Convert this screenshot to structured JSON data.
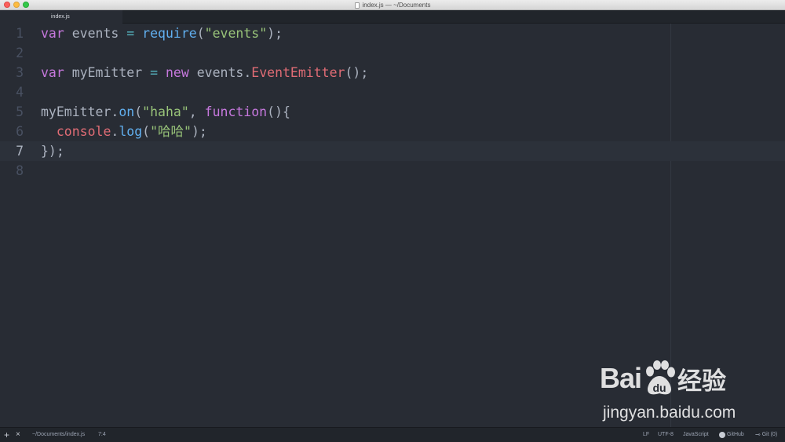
{
  "window": {
    "title": "index.js — ~/Documents"
  },
  "tabs": [
    {
      "label": "index.js"
    }
  ],
  "editor": {
    "cursor_line": 7,
    "lines": [
      {
        "number": "1",
        "tokens": [
          {
            "t": "var",
            "c": "kw"
          },
          {
            "t": " events ",
            "c": "pl"
          },
          {
            "t": "=",
            "c": "op"
          },
          {
            "t": " ",
            "c": "pl"
          },
          {
            "t": "require",
            "c": "fn"
          },
          {
            "t": "(",
            "c": "pl"
          },
          {
            "t": "\"events\"",
            "c": "str"
          },
          {
            "t": ");",
            "c": "pl"
          }
        ]
      },
      {
        "number": "2",
        "tokens": []
      },
      {
        "number": "3",
        "tokens": [
          {
            "t": "var",
            "c": "kw"
          },
          {
            "t": " myEmitter ",
            "c": "pl"
          },
          {
            "t": "=",
            "c": "op"
          },
          {
            "t": " ",
            "c": "pl"
          },
          {
            "t": "new",
            "c": "kw"
          },
          {
            "t": " events.",
            "c": "pl"
          },
          {
            "t": "EventEmitter",
            "c": "cls"
          },
          {
            "t": "();",
            "c": "pl"
          }
        ]
      },
      {
        "number": "4",
        "tokens": []
      },
      {
        "number": "5",
        "tokens": [
          {
            "t": "myEmitter.",
            "c": "pl"
          },
          {
            "t": "on",
            "c": "fn"
          },
          {
            "t": "(",
            "c": "pl"
          },
          {
            "t": "\"haha\"",
            "c": "str"
          },
          {
            "t": ", ",
            "c": "pl"
          },
          {
            "t": "function",
            "c": "kw"
          },
          {
            "t": "(){",
            "c": "pl"
          }
        ]
      },
      {
        "number": "6",
        "tokens": [
          {
            "t": "  ",
            "c": "pl"
          },
          {
            "t": "console",
            "c": "cls"
          },
          {
            "t": ".",
            "c": "pl"
          },
          {
            "t": "log",
            "c": "fn"
          },
          {
            "t": "(",
            "c": "pl"
          },
          {
            "t": "\"哈哈\"",
            "c": "str"
          },
          {
            "t": ");",
            "c": "pl"
          }
        ]
      },
      {
        "number": "7",
        "tokens": [
          {
            "t": "});",
            "c": "pl"
          }
        ]
      },
      {
        "number": "8",
        "tokens": []
      }
    ]
  },
  "watermark": {
    "logo_text_left": "Bai",
    "logo_text_right": "经验",
    "url": "jingyan.baidu.com"
  },
  "status_bar": {
    "add_label": "+",
    "close_label": "×",
    "file_path": "~/Documents/index.js",
    "cursor_position": "7:4",
    "line_ending": "LF",
    "encoding": "UTF-8",
    "grammar": "JavaScript",
    "github": "GitHub",
    "git": "Git (0)"
  },
  "colors": {
    "editor_bg": "#282c34",
    "keyword": "#c678dd",
    "function": "#61afef",
    "string": "#98c379",
    "class": "#e06c75",
    "operator": "#56b6c2",
    "plain": "#abb2bf"
  }
}
